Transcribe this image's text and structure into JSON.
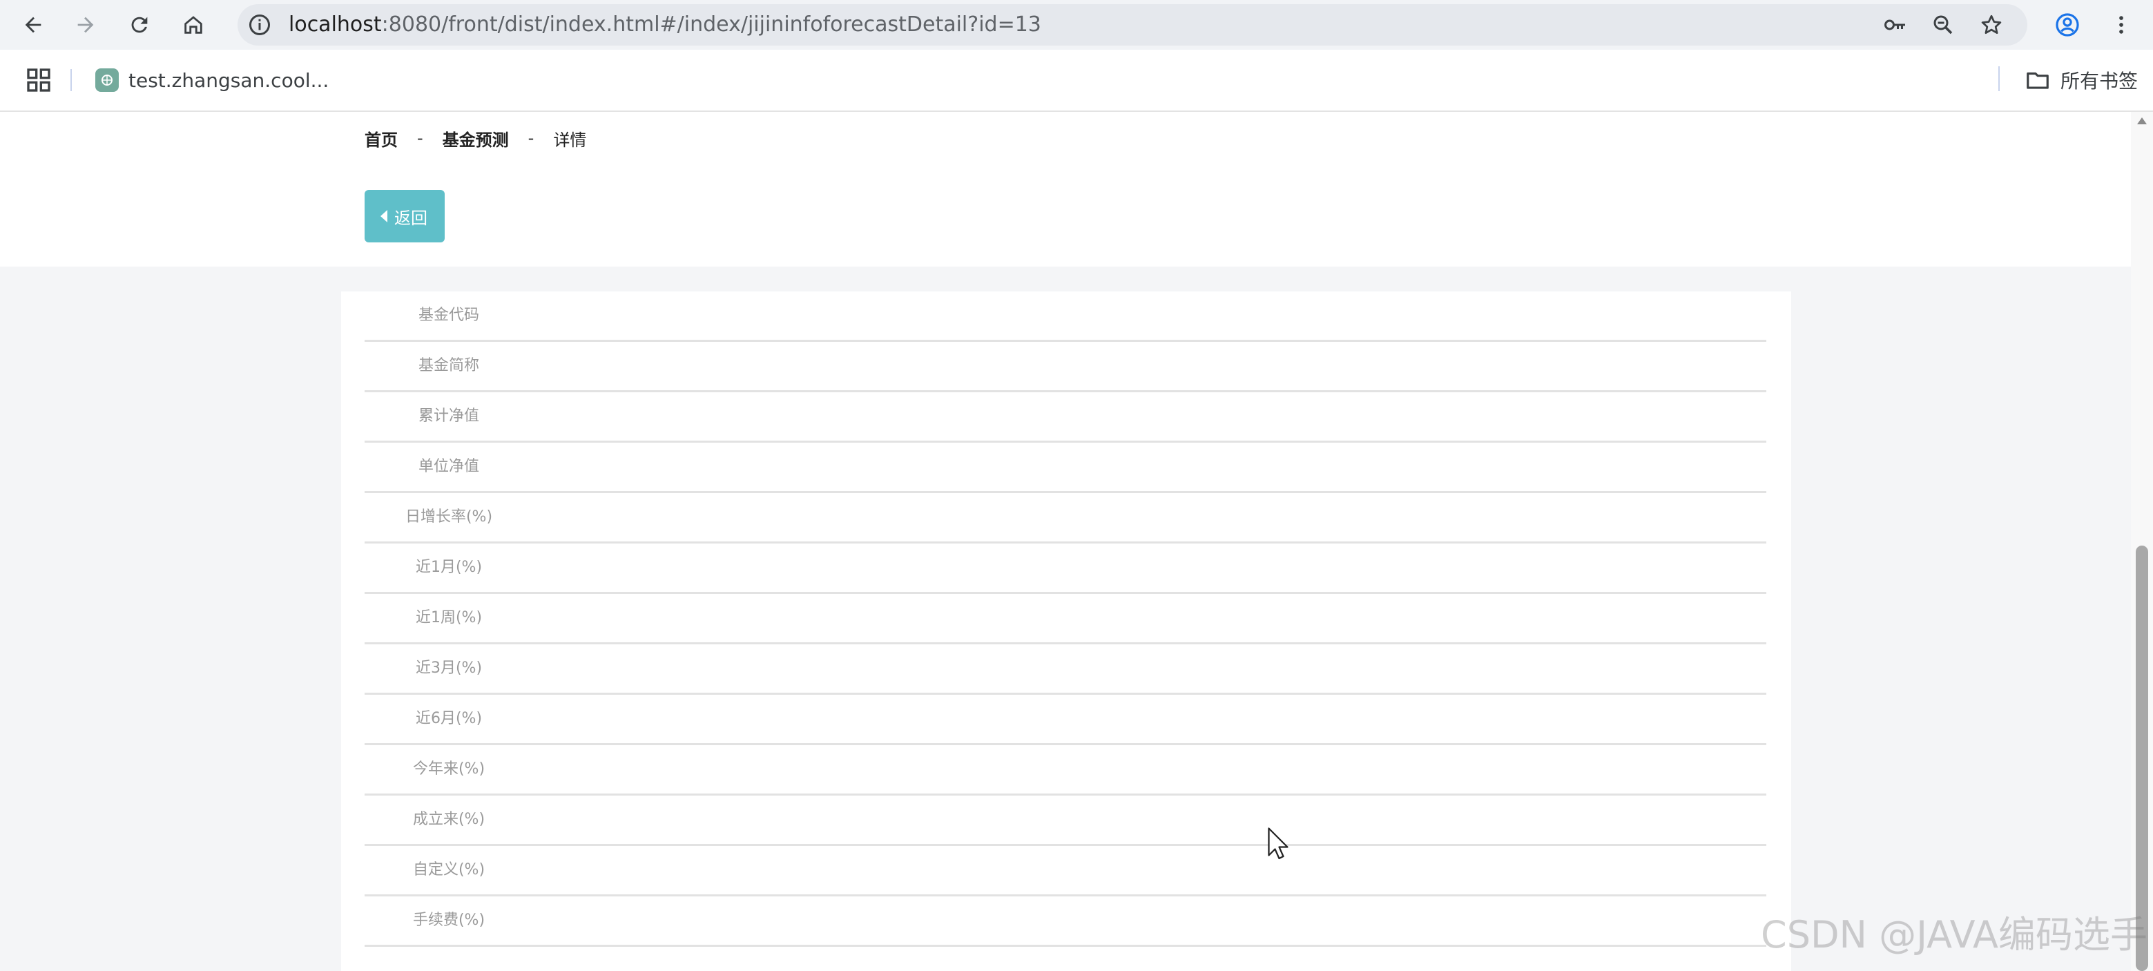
{
  "browser": {
    "url_host": "localhost",
    "url_path": ":8080/front/dist/index.html#/index/jijininfoforecastDetail?id=13",
    "bookmark_label": "test.zhangsan.cool...",
    "all_bookmarks_label": "所有书签"
  },
  "breadcrumb": {
    "home": "首页",
    "sep1": "-",
    "section": "基金预测",
    "sep2": "-",
    "current": "详情"
  },
  "back_button": {
    "label": "返回"
  },
  "detail": {
    "fields": [
      {
        "label": "基金代码",
        "value": ""
      },
      {
        "label": "基金简称",
        "value": ""
      },
      {
        "label": "累计净值",
        "value": ""
      },
      {
        "label": "单位净值",
        "value": ""
      },
      {
        "label": "日增长率(%)",
        "value": ""
      },
      {
        "label": "近1月(%)",
        "value": ""
      },
      {
        "label": "近1周(%)",
        "value": ""
      },
      {
        "label": "近3月(%)",
        "value": ""
      },
      {
        "label": "近6月(%)",
        "value": ""
      },
      {
        "label": "今年来(%)",
        "value": ""
      },
      {
        "label": "成立来(%)",
        "value": ""
      },
      {
        "label": "自定义(%)",
        "value": ""
      },
      {
        "label": "手续费(%)",
        "value": ""
      }
    ]
  },
  "watermark": "CSDN @JAVA编码选手",
  "colors": {
    "accent": "#5fbfc9",
    "chrome_bg": "#f1f3f6",
    "page_bg": "#f4f5f7"
  }
}
